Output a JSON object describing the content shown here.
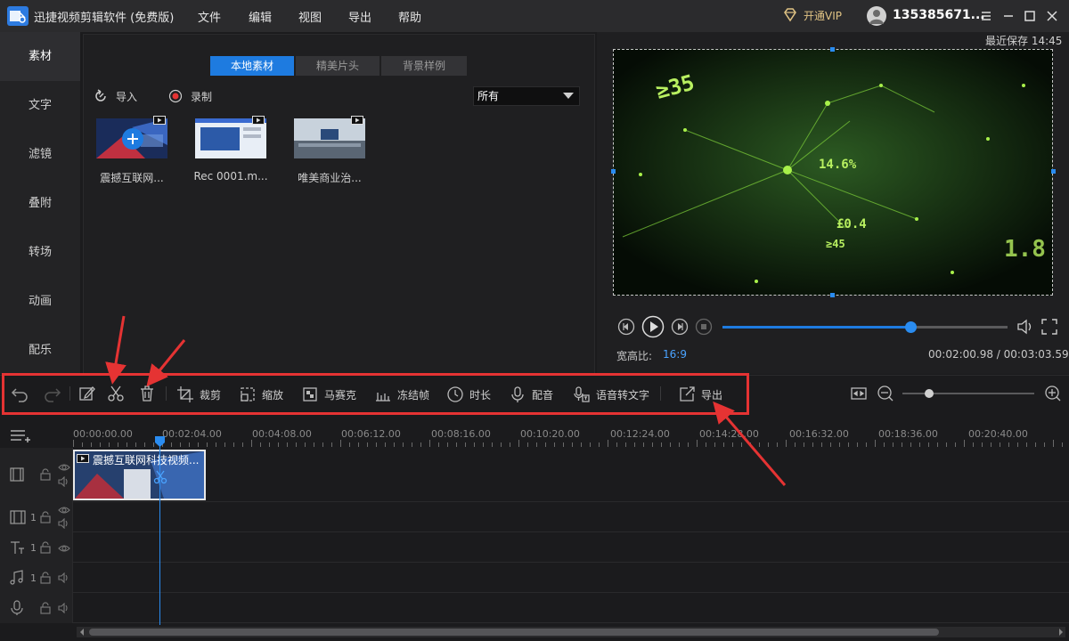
{
  "app": {
    "title": "迅捷视频剪辑软件 (免费版)",
    "menu": [
      "文件",
      "编辑",
      "视图",
      "导出",
      "帮助"
    ],
    "vip_label": "开通VIP",
    "username": "135385671..."
  },
  "sidebar": {
    "items": [
      {
        "label": "素材",
        "active": true
      },
      {
        "label": "文字"
      },
      {
        "label": "滤镜"
      },
      {
        "label": "叠附"
      },
      {
        "label": "转场"
      },
      {
        "label": "动画"
      },
      {
        "label": "配乐"
      }
    ]
  },
  "media": {
    "tabs": [
      {
        "label": "本地素材",
        "active": true
      },
      {
        "label": "精美片头"
      },
      {
        "label": "背景样例"
      }
    ],
    "import_label": "导入",
    "record_label": "录制",
    "filter_value": "所有",
    "items": [
      {
        "name": "震撼互联网..."
      },
      {
        "name": "Rec 0001.m..."
      },
      {
        "name": "唯美商业治..."
      }
    ]
  },
  "preview": {
    "save_status": "最近保存 14:45",
    "aspect_label": "宽高比:",
    "aspect_value": "16:9",
    "current_time": "00:02:00.98",
    "total_time": "00:03:03.59",
    "time_readout": "00:02:00.98 / 00:03:03.59",
    "progress": 0.66,
    "overlay_texts": [
      "≥35",
      "14.6%",
      "£0.4",
      "≥45",
      "1.8"
    ]
  },
  "toolbar": {
    "tools": [
      {
        "label": "裁剪",
        "icon": "crop-icon"
      },
      {
        "label": "缩放",
        "icon": "zoom-box-icon"
      },
      {
        "label": "马赛克",
        "icon": "mosaic-icon"
      },
      {
        "label": "冻结帧",
        "icon": "freeze-frame-icon"
      },
      {
        "label": "时长",
        "icon": "clock-icon"
      },
      {
        "label": "配音",
        "icon": "microphone-icon"
      },
      {
        "label": "语音转文字",
        "icon": "speech-to-text-icon"
      },
      {
        "label": "导出",
        "icon": "export-icon"
      }
    ],
    "zoom_level": 0.2
  },
  "timeline": {
    "ruler_labels": [
      "00:00:00.00",
      "00:02:04.00",
      "00:04:08.00",
      "00:06:12.00",
      "00:08:16.00",
      "00:10:20.00",
      "00:12:24.00",
      "00:14:28.00",
      "00:16:32.00",
      "00:18:36.00",
      "00:20:40.00"
    ],
    "clip_label": "震撼互联网科技视频...",
    "track_numbers": [
      "1",
      "1",
      "1"
    ]
  },
  "colors": {
    "accent": "#1e7be0",
    "annotation": "#e53333"
  }
}
